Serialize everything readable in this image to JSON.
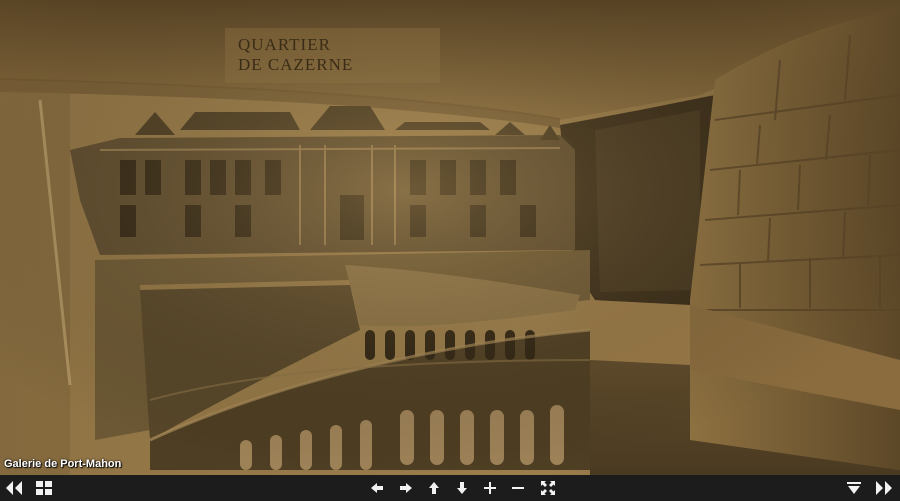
{
  "tour": {
    "title": "Galerie de Port-Mahon",
    "engraving_line1": "QUARTIER",
    "engraving_line2": "DE CAZERNE"
  },
  "toolbar": {
    "buttons": [
      {
        "name": "previous-scene-button",
        "icon": "double-chevron-left-icon"
      },
      {
        "name": "thumbnails-button",
        "icon": "grid-icon"
      },
      {
        "name": "pan-left-button",
        "icon": "arrow-left-icon"
      },
      {
        "name": "pan-right-button",
        "icon": "arrow-right-icon"
      },
      {
        "name": "pan-up-button",
        "icon": "arrow-up-icon"
      },
      {
        "name": "pan-down-button",
        "icon": "arrow-down-icon"
      },
      {
        "name": "zoom-in-button",
        "icon": "plus-icon"
      },
      {
        "name": "zoom-out-button",
        "icon": "minus-icon"
      },
      {
        "name": "fullscreen-button",
        "icon": "fullscreen-icon"
      },
      {
        "name": "hide-controls-button",
        "icon": "collapse-down-icon"
      },
      {
        "name": "next-scene-button",
        "icon": "double-chevron-right-icon"
      }
    ]
  },
  "colors": {
    "toolbar_bg": "#1c1c1c",
    "icon": "#f2f2f2",
    "stone_light": "#a98a58",
    "stone_dark": "#3d3220"
  }
}
